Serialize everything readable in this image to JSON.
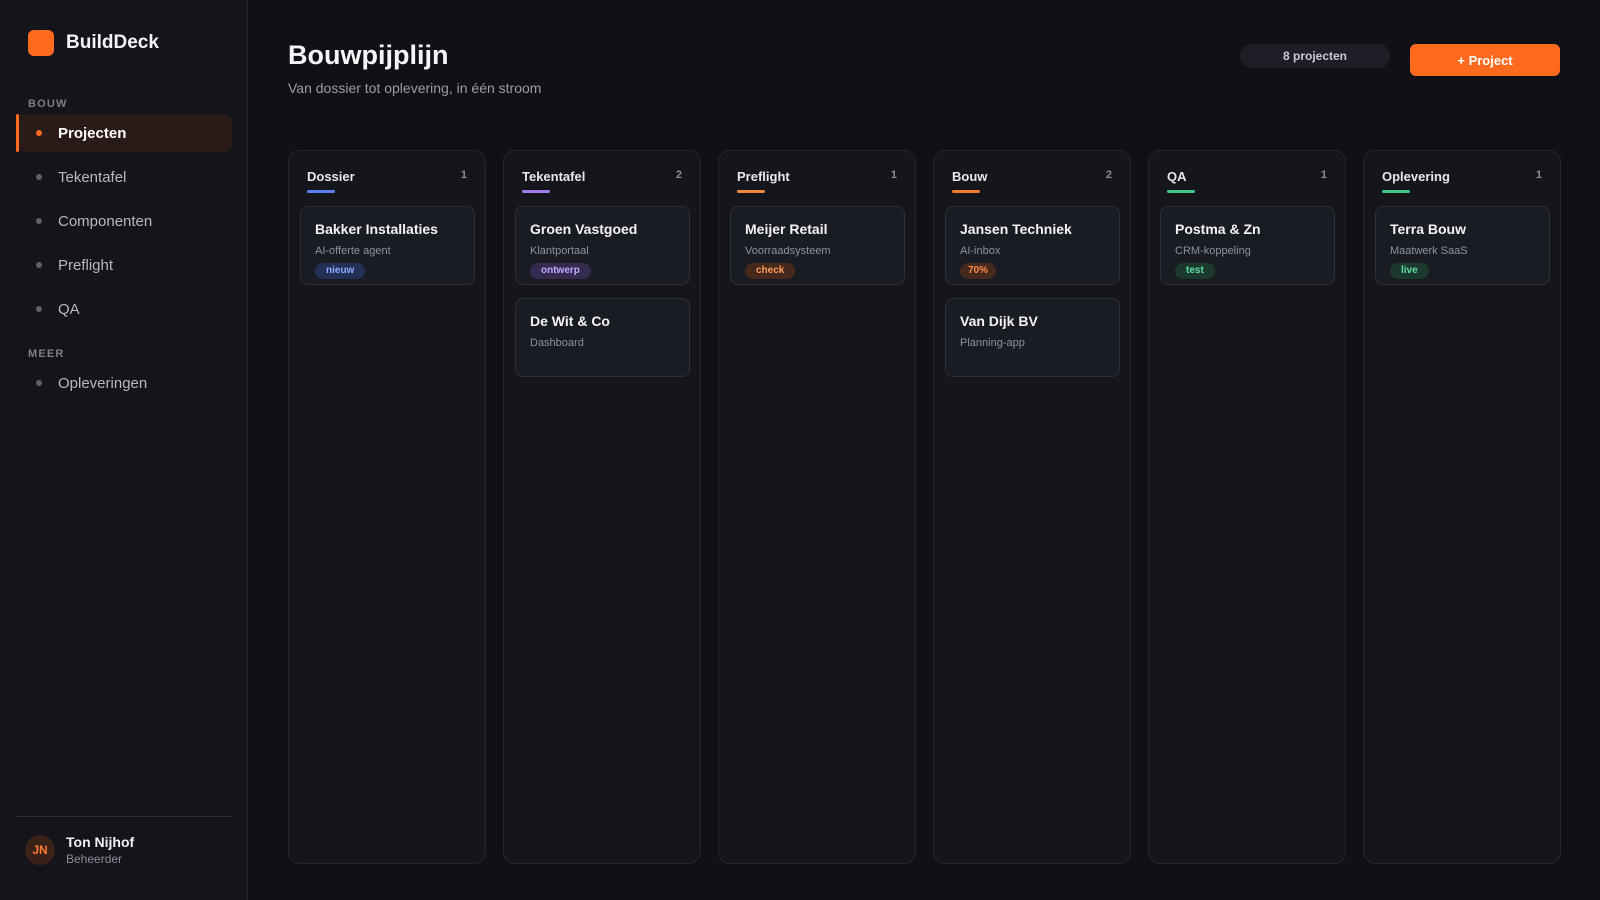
{
  "app": {
    "name": "BuildDeck"
  },
  "sidebar": {
    "sections": [
      {
        "label": "BOUW"
      },
      {
        "label": "MEER"
      }
    ],
    "items": [
      {
        "label": "Projecten",
        "active": true
      },
      {
        "label": "Tekentafel"
      },
      {
        "label": "Componenten"
      },
      {
        "label": "Preflight"
      },
      {
        "label": "QA"
      },
      {
        "label": "Opleveringen"
      }
    ],
    "user": {
      "initials": "JN",
      "name": "Ton Nijhof",
      "role": "Beheerder"
    }
  },
  "header": {
    "title": "Bouwpijplijn",
    "subtitle": "Van dossier tot oplevering, in één stroom",
    "count_label": "8 projecten",
    "add_label": "+ Project"
  },
  "colors": {
    "accent": "#ff6a1f",
    "dossier": "#5b7ff0",
    "tekentafel": "#a07be8",
    "preflight": "#f0863a",
    "bouw": "#f07a2e",
    "qa": "#3cc98a",
    "oplevering": "#3cc98a"
  },
  "columns": [
    {
      "title": "Dossier",
      "count": "1",
      "cards": [
        {
          "title": "Bakker Installaties",
          "subtitle": "AI-offerte agent",
          "tag": "nieuw"
        }
      ]
    },
    {
      "title": "Tekentafel",
      "count": "2",
      "cards": [
        {
          "title": "Groen Vastgoed",
          "subtitle": "Klantportaal",
          "tag": "ontwerp"
        },
        {
          "title": "De Wit & Co",
          "subtitle": "Dashboard"
        }
      ]
    },
    {
      "title": "Preflight",
      "count": "1",
      "cards": [
        {
          "title": "Meijer Retail",
          "subtitle": "Voorraadsysteem",
          "tag": "check"
        }
      ]
    },
    {
      "title": "Bouw",
      "count": "2",
      "cards": [
        {
          "title": "Jansen Techniek",
          "subtitle": "AI-inbox",
          "tag": "70%"
        },
        {
          "title": "Van Dijk BV",
          "subtitle": "Planning-app"
        }
      ]
    },
    {
      "title": "QA",
      "count": "1",
      "cards": [
        {
          "title": "Postma & Zn",
          "subtitle": "CRM-koppeling",
          "tag": "test"
        }
      ]
    },
    {
      "title": "Oplevering",
      "count": "1",
      "cards": [
        {
          "title": "Terra Bouw",
          "subtitle": "Maatwerk SaaS",
          "tag": "live"
        }
      ]
    }
  ]
}
